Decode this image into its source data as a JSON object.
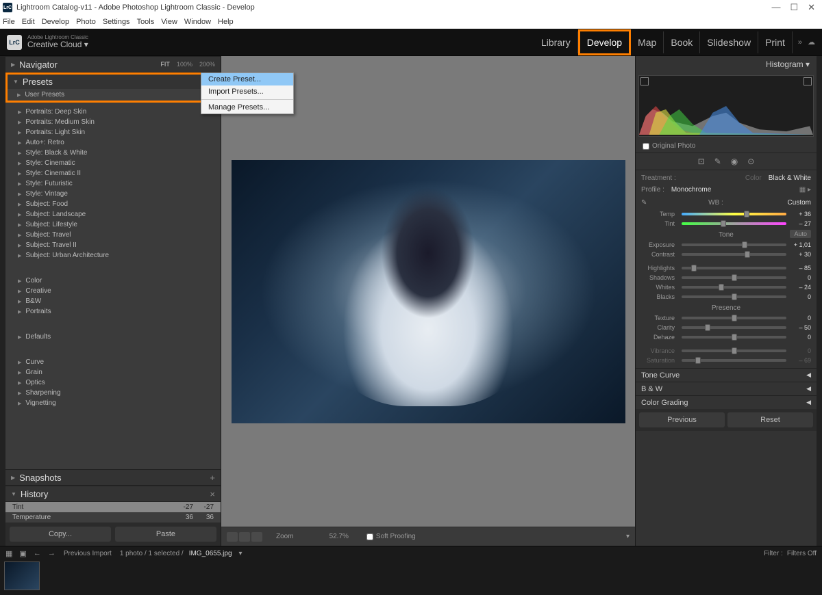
{
  "titlebar": {
    "icon": "LrC",
    "title": "Lightroom Catalog-v11 - Adobe Photoshop Lightroom Classic - Develop"
  },
  "menubar": [
    "File",
    "Edit",
    "Develop",
    "Photo",
    "Settings",
    "Tools",
    "View",
    "Window",
    "Help"
  ],
  "topstrip": {
    "product_sub": "Adobe Lightroom Classic",
    "product_main": "Creative Cloud  ▾",
    "modules": [
      "Library",
      "Develop",
      "Map",
      "Book",
      "Slideshow",
      "Print"
    ],
    "active_module": "Develop"
  },
  "left": {
    "navigator": {
      "label": "Navigator",
      "opts": [
        "FIT",
        "100%",
        "200%"
      ],
      "active": "FIT"
    },
    "presets": {
      "label": "Presets",
      "user_label": "User Presets",
      "items1": [
        "Portraits: Deep Skin",
        "Portraits: Medium Skin",
        "Portraits: Light Skin",
        "Auto+: Retro",
        "Style: Black & White",
        "Style: Cinematic",
        "Style: Cinematic II",
        "Style: Futuristic",
        "Style: Vintage",
        "Subject: Food",
        "Subject: Landscape",
        "Subject: Lifestyle",
        "Subject: Travel",
        "Subject: Travel II",
        "Subject: Urban Architecture"
      ],
      "items2": [
        "Color",
        "Creative",
        "B&W",
        "Portraits"
      ],
      "items3": [
        "Defaults"
      ],
      "items4": [
        "Curve",
        "Grain",
        "Optics",
        "Sharpening",
        "Vignetting"
      ]
    },
    "snapshots": "Snapshots",
    "history": {
      "label": "History",
      "rows": [
        {
          "l": "Tint",
          "v1": "-27",
          "v2": "-27",
          "sel": true
        },
        {
          "l": "Temperature",
          "v1": "36",
          "v2": "36",
          "sel": false
        }
      ]
    },
    "copy": "Copy...",
    "paste": "Paste"
  },
  "context": {
    "create": "Create Preset...",
    "import": "Import Presets...",
    "manage": "Manage Presets..."
  },
  "center": {
    "zoom_label": "Zoom",
    "zoom_value": "52.7%",
    "soft_proof": "Soft Proofing"
  },
  "right": {
    "histogram": "Histogram ▾",
    "orig": "Original Photo",
    "treatment": {
      "l": "Treatment :",
      "c": "Color",
      "bw": "Black & White"
    },
    "profile": {
      "l": "Profile :",
      "v": "Monochrome"
    },
    "wb": {
      "l": "WB :",
      "v": "Custom"
    },
    "sliders": {
      "temp": {
        "l": "Temp",
        "v": "+ 36",
        "pos": 62
      },
      "tint": {
        "l": "Tint",
        "v": "– 27",
        "pos": 40
      },
      "tone": "Tone",
      "auto": "Auto",
      "exposure": {
        "l": "Exposure",
        "v": "+ 1,01",
        "pos": 60
      },
      "contrast": {
        "l": "Contrast",
        "v": "+ 30",
        "pos": 63
      },
      "highlights": {
        "l": "Highlights",
        "v": "– 85",
        "pos": 12
      },
      "shadows": {
        "l": "Shadows",
        "v": "0",
        "pos": 50
      },
      "whites": {
        "l": "Whites",
        "v": "– 24",
        "pos": 38
      },
      "blacks": {
        "l": "Blacks",
        "v": "0",
        "pos": 50
      },
      "presence": "Presence",
      "texture": {
        "l": "Texture",
        "v": "0",
        "pos": 50
      },
      "clarity": {
        "l": "Clarity",
        "v": "– 50",
        "pos": 25
      },
      "dehaze": {
        "l": "Dehaze",
        "v": "0",
        "pos": 50
      },
      "vibrance": {
        "l": "Vibrance",
        "v": "0",
        "pos": 50
      },
      "saturation": {
        "l": "Saturation",
        "v": "– 69",
        "pos": 16
      }
    },
    "panels": [
      "Tone Curve",
      "B & W",
      "Color Grading"
    ],
    "previous": "Previous",
    "reset": "Reset"
  },
  "filmstrip": {
    "crumb1": "Previous Import",
    "crumb2": "1 photo / 1 selected /",
    "filename": "IMG_0655.jpg",
    "filter_l": "Filter :",
    "filter_v": "Filters Off"
  }
}
